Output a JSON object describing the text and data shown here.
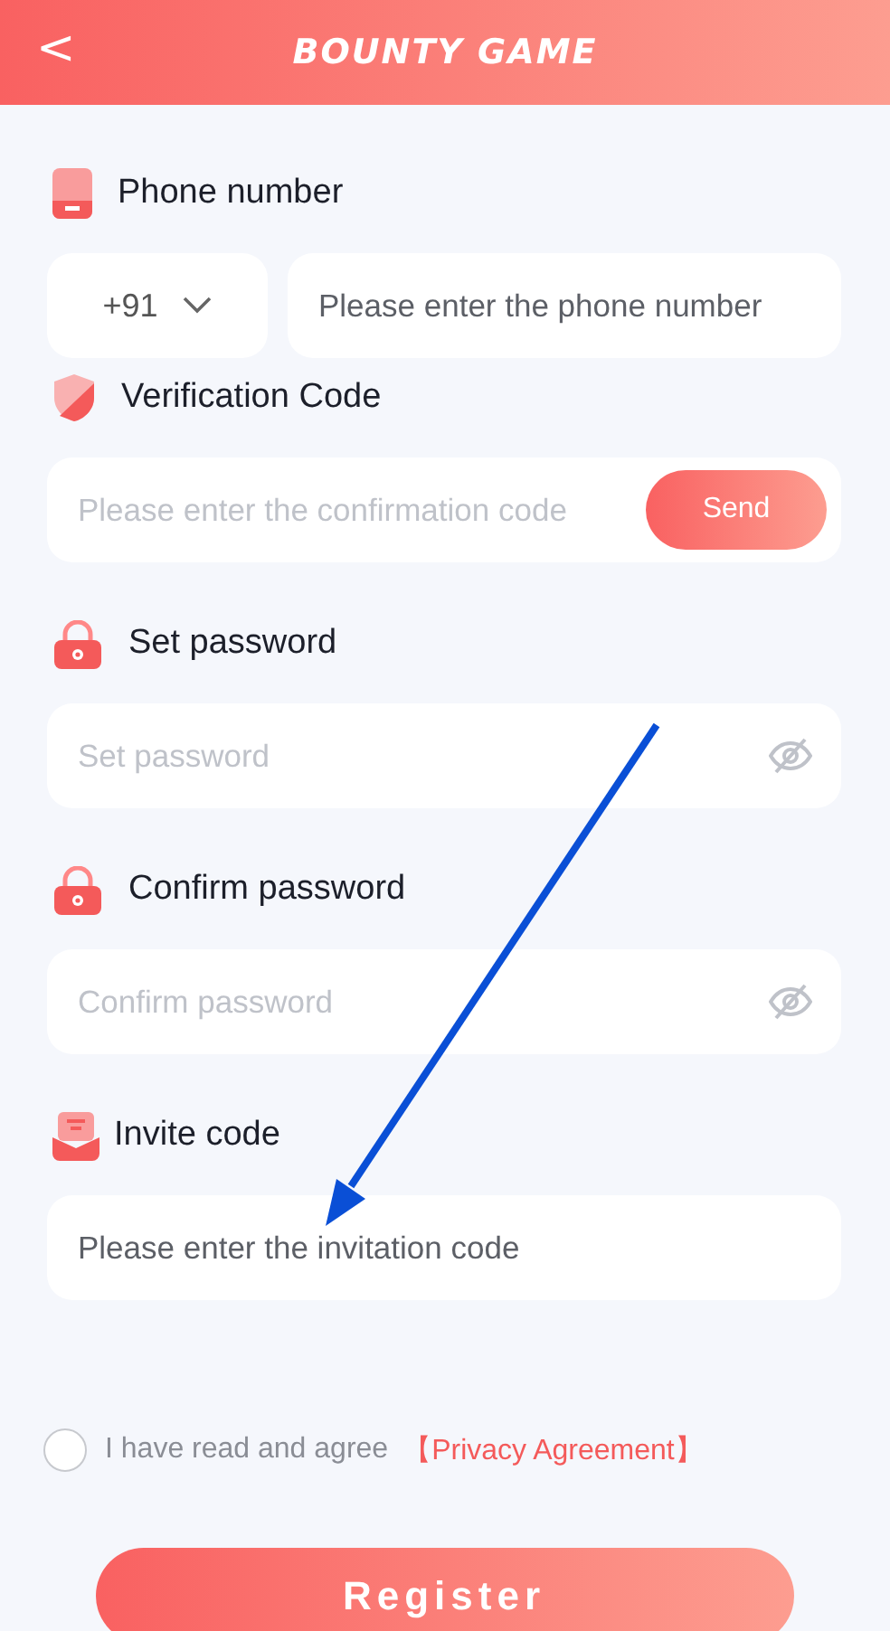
{
  "header": {
    "back": "<",
    "title": "BOUNTY GAME"
  },
  "fields": [
    {
      "kind": "phone",
      "label": "Phone number",
      "country_code": "+91",
      "placeholder": "Please enter the phone number"
    },
    {
      "kind": "code",
      "label": "Verification Code",
      "placeholder": "Please enter the confirmation code",
      "button": "Send"
    },
    {
      "kind": "password",
      "label": "Set password",
      "placeholder": "Set password"
    },
    {
      "kind": "password",
      "label": "Confirm password",
      "placeholder": "Confirm password"
    },
    {
      "kind": "invite",
      "label": "Invite code",
      "placeholder": "Please enter the invitation code"
    }
  ],
  "agreement": {
    "checked": false,
    "text": "I have read and agree",
    "link": "【Privacy Agreement】"
  },
  "register_button": "Register"
}
